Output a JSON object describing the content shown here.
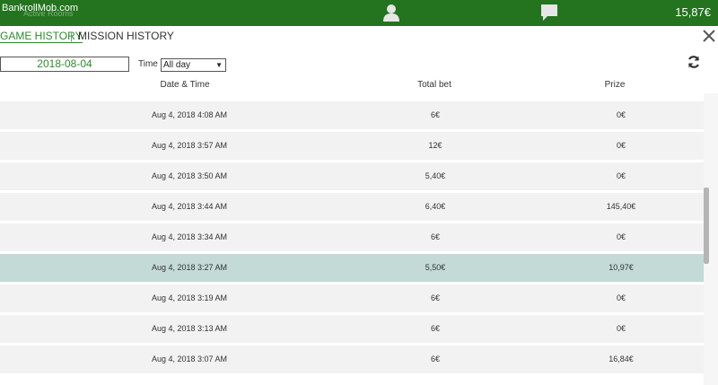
{
  "header": {
    "brand": "BankrollMob.com",
    "under_text": "Active Rooms",
    "balance": "15,87€",
    "icons": {
      "user": "user-icon",
      "chat": "chat-icon"
    }
  },
  "tabs": {
    "game_history": "GAME HISTORY",
    "separator": "|",
    "mission_history": "MISSION HISTORY"
  },
  "filters": {
    "date_value": "2018-08-04",
    "time_label": "Time",
    "time_selected": "All day"
  },
  "table": {
    "columns": [
      "Date & Time",
      "Total bet",
      "Prize"
    ],
    "rows": [
      {
        "date": "Aug 4, 2018 4:08 AM",
        "bet": "6€",
        "prize": "0€"
      },
      {
        "date": "Aug 4, 2018 3:57 AM",
        "bet": "12€",
        "prize": "0€"
      },
      {
        "date": "Aug 4, 2018 3:50 AM",
        "bet": "5,40€",
        "prize": "0€"
      },
      {
        "date": "Aug 4, 2018 3:44 AM",
        "bet": "6,40€",
        "prize": "145,40€"
      },
      {
        "date": "Aug 4, 2018 3:34 AM",
        "bet": "6€",
        "prize": "0€"
      },
      {
        "date": "Aug 4, 2018 3:27 AM",
        "bet": "5,50€",
        "prize": "10,97€"
      },
      {
        "date": "Aug 4, 2018 3:19 AM",
        "bet": "6€",
        "prize": "0€"
      },
      {
        "date": "Aug 4, 2018 3:13 AM",
        "bet": "6€",
        "prize": "0€"
      },
      {
        "date": "Aug 4, 2018 3:07 AM",
        "bet": "6€",
        "prize": "16,84€"
      }
    ]
  },
  "colors": {
    "header_bg": "#24731f",
    "accent": "#2e8b2e",
    "row_bg": "#f2f2f2",
    "row_highlight": "#c3dad6"
  }
}
